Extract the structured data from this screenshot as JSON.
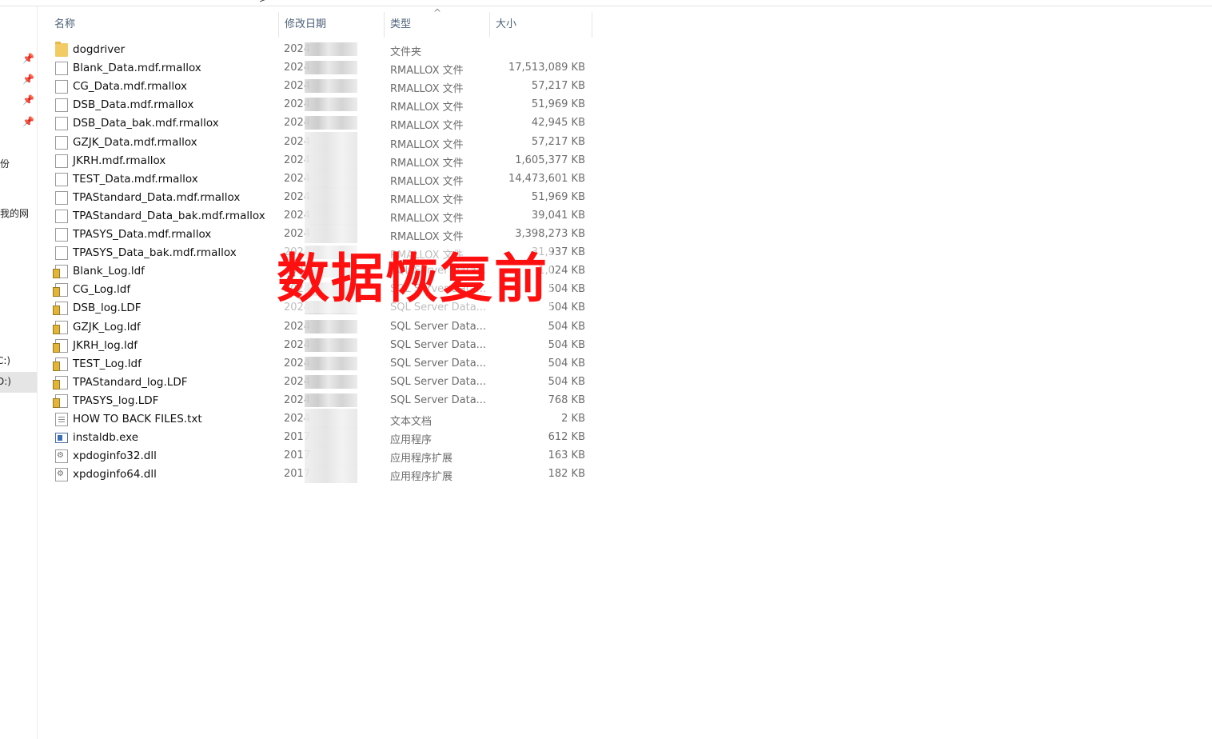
{
  "window": {
    "title_fragment": "·>",
    "columns": {
      "name": "名称",
      "modified": "修改日期",
      "type": "类型",
      "size": "大小"
    }
  },
  "nav": {
    "pins": [
      "pin-icon",
      "pin-icon",
      "pin-icon",
      "pin-icon"
    ],
    "items": [
      {
        "label": "份"
      },
      {
        "label": "我的网"
      },
      {
        "label": "C:)"
      },
      {
        "label": "D:)"
      }
    ]
  },
  "files": [
    {
      "icon": "folder-icon",
      "name": "dogdriver",
      "date": "2024",
      "type": "文件夹",
      "size": ""
    },
    {
      "icon": "file-icon",
      "name": "Blank_Data.mdf.rmallox",
      "date": "2024",
      "type": "RMALLOX 文件",
      "size": "17,513,089 KB"
    },
    {
      "icon": "file-icon",
      "name": "CG_Data.mdf.rmallox",
      "date": "2024",
      "type": "RMALLOX 文件",
      "size": "57,217 KB"
    },
    {
      "icon": "file-icon",
      "name": "DSB_Data.mdf.rmallox",
      "date": "2024",
      "type": "RMALLOX 文件",
      "size": "51,969 KB"
    },
    {
      "icon": "file-icon",
      "name": "DSB_Data_bak.mdf.rmallox",
      "date": "2024",
      "type": "RMALLOX 文件",
      "size": "42,945 KB"
    },
    {
      "icon": "file-icon",
      "name": "GZJK_Data.mdf.rmallox",
      "date": "2024",
      "type": "RMALLOX 文件",
      "size": "57,217 KB"
    },
    {
      "icon": "file-icon",
      "name": "JKRH.mdf.rmallox",
      "date": "2024",
      "type": "RMALLOX 文件",
      "size": "1,605,377 KB"
    },
    {
      "icon": "file-icon",
      "name": "TEST_Data.mdf.rmallox",
      "date": "2024",
      "type": "RMALLOX 文件",
      "size": "14,473,601 KB"
    },
    {
      "icon": "file-icon",
      "name": "TPAStandard_Data.mdf.rmallox",
      "date": "2024",
      "type": "RMALLOX 文件",
      "size": "51,969 KB"
    },
    {
      "icon": "file-icon",
      "name": "TPAStandard_Data_bak.mdf.rmallox",
      "date": "2024",
      "type": "RMALLOX 文件",
      "size": "39,041 KB"
    },
    {
      "icon": "file-icon",
      "name": "TPASYS_Data.mdf.rmallox",
      "date": "2024",
      "type": "RMALLOX 文件",
      "size": "3,398,273 KB"
    },
    {
      "icon": "file-icon",
      "name": "TPASYS_Data_bak.mdf.rmallox",
      "date": "2024",
      "type": "RMALLOX 文件",
      "size": "31,937 KB"
    },
    {
      "icon": "database-log-icon",
      "name": "Blank_Log.ldf",
      "date": "2024",
      "type": "SQL Server Data...",
      "size": "1,024 KB"
    },
    {
      "icon": "database-log-icon",
      "name": "CG_Log.ldf",
      "date": "2024",
      "type": "SQL Server Data...",
      "size": "504 KB"
    },
    {
      "icon": "database-log-icon",
      "name": "DSB_log.LDF",
      "date": "2024",
      "type": "SQL Server Data...",
      "size": "504 KB"
    },
    {
      "icon": "database-log-icon",
      "name": "GZJK_Log.ldf",
      "date": "2024",
      "type": "SQL Server Data...",
      "size": "504 KB"
    },
    {
      "icon": "database-log-icon",
      "name": "JKRH_log.ldf",
      "date": "2024",
      "type": "SQL Server Data...",
      "size": "504 KB"
    },
    {
      "icon": "database-log-icon",
      "name": "TEST_Log.ldf",
      "date": "2024",
      "type": "SQL Server Data...",
      "size": "504 KB"
    },
    {
      "icon": "database-log-icon",
      "name": "TPAStandard_log.LDF",
      "date": "2024",
      "type": "SQL Server Data...",
      "size": "504 KB"
    },
    {
      "icon": "database-log-icon",
      "name": "TPASYS_log.LDF",
      "date": "2024",
      "type": "SQL Server Data...",
      "size": "768 KB"
    },
    {
      "icon": "text-file-icon",
      "name": "HOW TO BACK FILES.txt",
      "date": "2024",
      "type": "文本文档",
      "size": "2 KB"
    },
    {
      "icon": "exe-icon",
      "name": "instaldb.exe",
      "date": "2017",
      "type": "应用程序",
      "size": "612 KB"
    },
    {
      "icon": "dll-icon",
      "name": "xpdoginfo32.dll",
      "date": "2017",
      "type": "应用程序扩展",
      "size": "163 KB"
    },
    {
      "icon": "dll-icon",
      "name": "xpdoginfo64.dll",
      "date": "2017",
      "type": "应用程序扩展",
      "size": "182 KB"
    }
  ],
  "watermark": {
    "text": "数据恢复前",
    "color": "#ff1010"
  }
}
